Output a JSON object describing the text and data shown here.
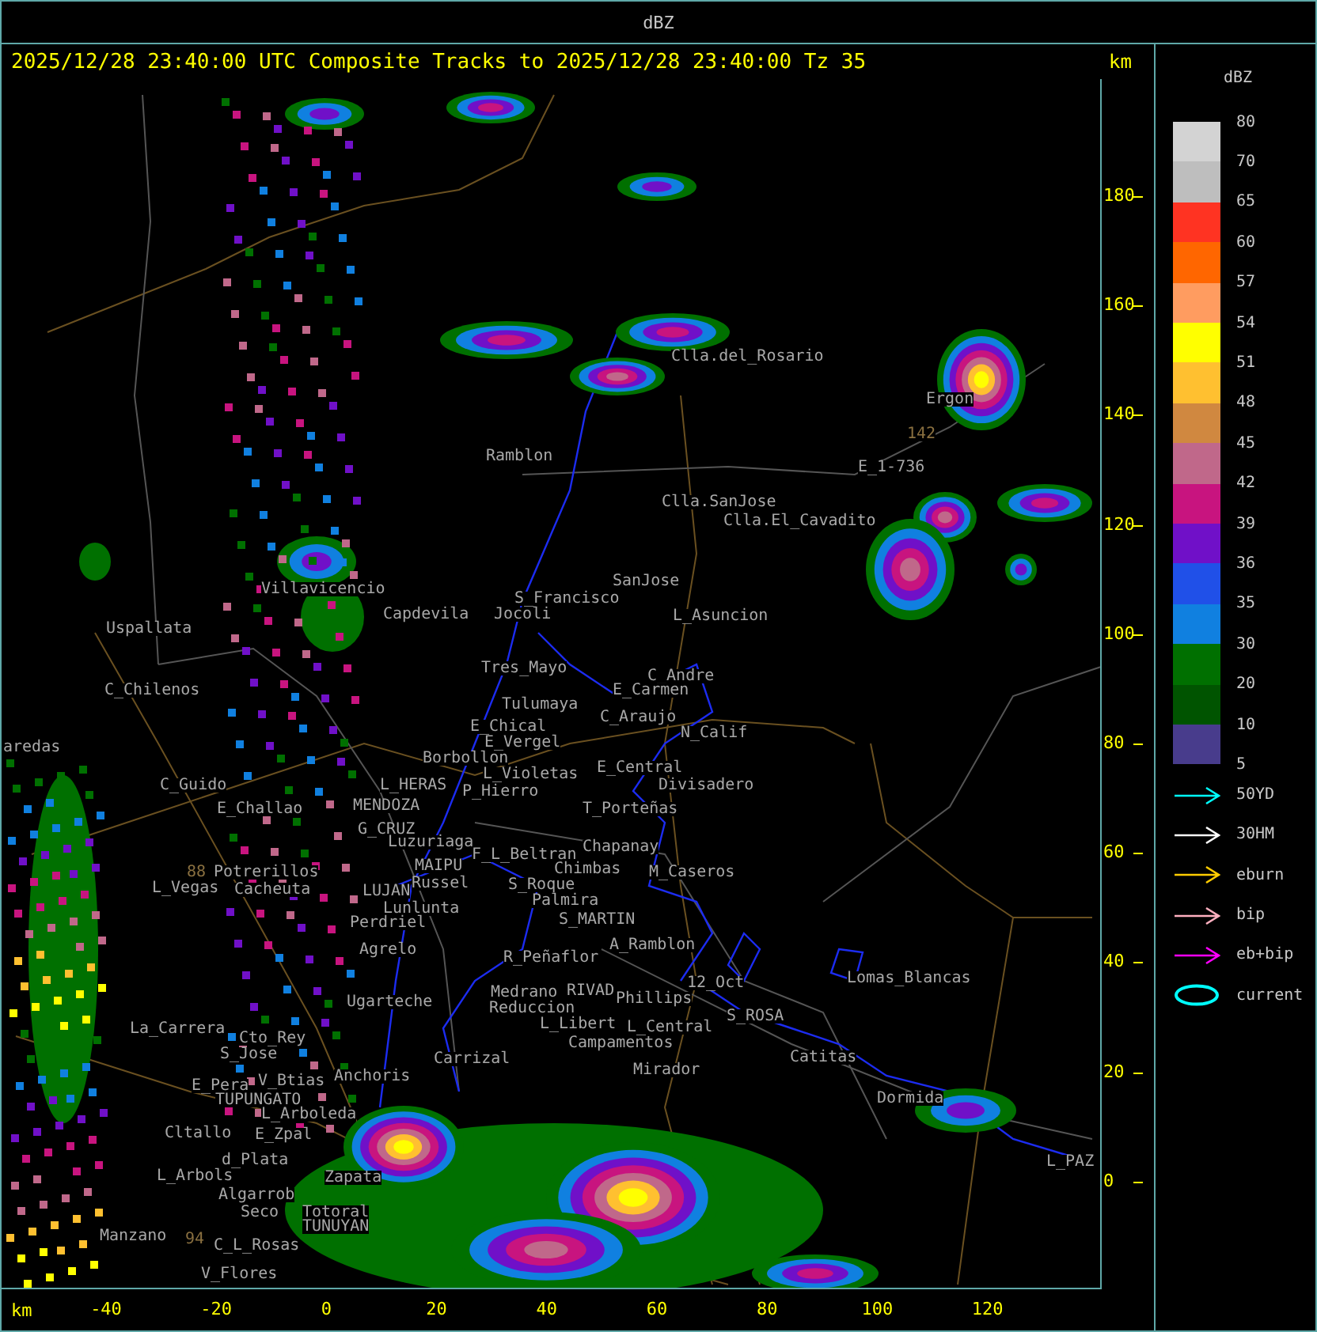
{
  "title": "dBZ",
  "header": {
    "text": "2025/12/28 23:40:00 UTC Composite Tracks to 2025/12/28 23:40:00 Tz 35",
    "unit": "km"
  },
  "map": {
    "places": [
      {
        "name": "Clla.del_Rosario",
        "kind": "town"
      },
      {
        "name": "Ergon",
        "kind": "town"
      },
      {
        "name": "142",
        "kind": "road"
      },
      {
        "name": "Ramblon",
        "kind": "town"
      },
      {
        "name": "E_1-736",
        "kind": "town"
      },
      {
        "name": "Clla.SanJose",
        "kind": "town"
      },
      {
        "name": "Clla.El_Cavadito",
        "kind": "town"
      },
      {
        "name": "Villavicencio",
        "kind": "town"
      },
      {
        "name": "S_Francisco",
        "kind": "town"
      },
      {
        "name": "SanJose",
        "kind": "town"
      },
      {
        "name": "Uspallata",
        "kind": "town"
      },
      {
        "name": "Capdevila",
        "kind": "town"
      },
      {
        "name": "Jocoli",
        "kind": "town"
      },
      {
        "name": "L_Asuncion",
        "kind": "town"
      },
      {
        "name": "Tres_Mayo",
        "kind": "town"
      },
      {
        "name": "C_Andre",
        "kind": "town"
      },
      {
        "name": "C_Chilenos",
        "kind": "town"
      },
      {
        "name": "E_Carmen",
        "kind": "town"
      },
      {
        "name": "Tulumaya",
        "kind": "town"
      },
      {
        "name": "aredas",
        "kind": "town"
      },
      {
        "name": "E_Chical",
        "kind": "town"
      },
      {
        "name": "E_Vergel",
        "kind": "town"
      },
      {
        "name": "C_Araujo",
        "kind": "town"
      },
      {
        "name": "N_Calif",
        "kind": "town"
      },
      {
        "name": "Borbollon",
        "kind": "town"
      },
      {
        "name": "L_Violetas",
        "kind": "town"
      },
      {
        "name": "E_Central",
        "kind": "town"
      },
      {
        "name": "C_Guido",
        "kind": "town"
      },
      {
        "name": "L_HERAS",
        "kind": "town"
      },
      {
        "name": "P_Hierro",
        "kind": "town"
      },
      {
        "name": "Divisadero",
        "kind": "town"
      },
      {
        "name": "E_Challao",
        "kind": "town"
      },
      {
        "name": "MENDOZA",
        "kind": "town"
      },
      {
        "name": "T_Porteñas",
        "kind": "town"
      },
      {
        "name": "G_CRUZ",
        "kind": "town"
      },
      {
        "name": "Luzuriaga",
        "kind": "town"
      },
      {
        "name": "F_L_Beltran",
        "kind": "town"
      },
      {
        "name": "Chapanay",
        "kind": "town"
      },
      {
        "name": "88",
        "kind": "road"
      },
      {
        "name": "Potrerillos",
        "kind": "town"
      },
      {
        "name": "MAIPU",
        "kind": "town"
      },
      {
        "name": "Chimbas",
        "kind": "town"
      },
      {
        "name": "M_Caseros",
        "kind": "town"
      },
      {
        "name": "L_Vegas",
        "kind": "town"
      },
      {
        "name": "Cacheuta",
        "kind": "town"
      },
      {
        "name": "LUJAN",
        "kind": "town"
      },
      {
        "name": "Russel",
        "kind": "town"
      },
      {
        "name": "S_Roque",
        "kind": "town"
      },
      {
        "name": "Lunlunta",
        "kind": "town"
      },
      {
        "name": "Palmira",
        "kind": "town"
      },
      {
        "name": "Perdriel",
        "kind": "town"
      },
      {
        "name": "S_MARTIN",
        "kind": "town"
      },
      {
        "name": "Agrelo",
        "kind": "town"
      },
      {
        "name": "R_Peñaflor",
        "kind": "town"
      },
      {
        "name": "A_Ramblon",
        "kind": "town"
      },
      {
        "name": "La_Carrera",
        "kind": "town"
      },
      {
        "name": "Ugarteche",
        "kind": "town"
      },
      {
        "name": "Medrano",
        "kind": "town"
      },
      {
        "name": "RIVAD",
        "kind": "town"
      },
      {
        "name": "Reduccion",
        "kind": "town"
      },
      {
        "name": "Phillips",
        "kind": "town"
      },
      {
        "name": "12_Oct",
        "kind": "town"
      },
      {
        "name": "L_Libert",
        "kind": "town"
      },
      {
        "name": "L_Central",
        "kind": "town"
      },
      {
        "name": "S_ROSA",
        "kind": "town"
      },
      {
        "name": "Lomas_Blancas",
        "kind": "town"
      },
      {
        "name": "Cto_Rey",
        "kind": "town"
      },
      {
        "name": "S_Jose",
        "kind": "town"
      },
      {
        "name": "Carrizal",
        "kind": "town"
      },
      {
        "name": "Campamentos",
        "kind": "town"
      },
      {
        "name": "Mirador",
        "kind": "town"
      },
      {
        "name": "Catitas",
        "kind": "town"
      },
      {
        "name": "E_Pera",
        "kind": "town"
      },
      {
        "name": "V_Btias",
        "kind": "town"
      },
      {
        "name": "Anchoris",
        "kind": "town"
      },
      {
        "name": "TUPUNGATO",
        "kind": "town"
      },
      {
        "name": "Dormida",
        "kind": "town"
      },
      {
        "name": "L_Arboleda",
        "kind": "town"
      },
      {
        "name": "Cltallo",
        "kind": "town"
      },
      {
        "name": "E_Zpal",
        "kind": "town"
      },
      {
        "name": "d_Plata",
        "kind": "town"
      },
      {
        "name": "L_PAZ",
        "kind": "town"
      },
      {
        "name": "L_Arbols",
        "kind": "town"
      },
      {
        "name": "Zapata",
        "kind": "town"
      },
      {
        "name": "Algarrob",
        "kind": "town"
      },
      {
        "name": "Seco",
        "kind": "town"
      },
      {
        "name": "Totoral",
        "kind": "town"
      },
      {
        "name": "Manzano",
        "kind": "town"
      },
      {
        "name": "94",
        "kind": "road"
      },
      {
        "name": "C_L_Rosas",
        "kind": "town"
      },
      {
        "name": "TUNUYAN",
        "kind": "town"
      },
      {
        "name": "V_Flores",
        "kind": "town"
      }
    ]
  },
  "axes": {
    "y_ticks": [
      "180",
      "160",
      "140",
      "120",
      "100",
      "80",
      "60",
      "40",
      "20",
      "0"
    ],
    "x_ticks": [
      "-40",
      "-20",
      "0",
      "20",
      "40",
      "60",
      "80",
      "100",
      "120"
    ],
    "x_unit": "km"
  },
  "legend": {
    "title": "dBZ",
    "labels": [
      "80",
      "70",
      "65",
      "60",
      "57",
      "54",
      "51",
      "48",
      "45",
      "42",
      "39",
      "36",
      "35",
      "30",
      "20",
      "10",
      "5"
    ],
    "bins": [
      {
        "color": "#d3d3d3"
      },
      {
        "color": "#bebebe"
      },
      {
        "color": "#ff3322"
      },
      {
        "color": "#ff6600"
      },
      {
        "color": "#ff9c60"
      },
      {
        "color": "#ffff00"
      },
      {
        "color": "#ffc030"
      },
      {
        "color": "#d08840"
      },
      {
        "color": "#c0688a"
      },
      {
        "color": "#c8147f"
      },
      {
        "color": "#7010c8"
      },
      {
        "color": "#2050e8"
      },
      {
        "color": "#1080e0"
      },
      {
        "color": "#007000"
      },
      {
        "color": "#005400"
      },
      {
        "color": "#483c8c"
      }
    ],
    "tracks": [
      {
        "label": "50YD",
        "kind": "arrow",
        "color": "#00ffff"
      },
      {
        "label": "30HM",
        "kind": "arrow",
        "color": "#ffffff"
      },
      {
        "label": "eburn",
        "kind": "arrow",
        "color": "#ffcc00"
      },
      {
        "label": "bip",
        "kind": "arrow",
        "color": "#ffb0c0"
      },
      {
        "label": "eb+bip",
        "kind": "arrow",
        "color": "#ff00ff"
      },
      {
        "label": "current",
        "kind": "ellipse",
        "color": "#00ffff"
      }
    ]
  }
}
